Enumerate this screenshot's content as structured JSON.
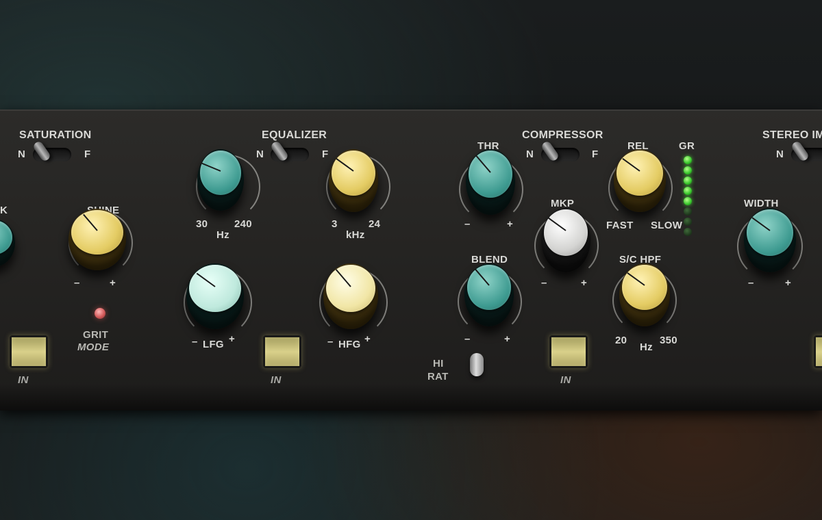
{
  "sections": {
    "saturation": "SATURATION",
    "equalizer": "EQUALIZER",
    "compressor": "COMPRESSOR",
    "stereo": "STEREO IM"
  },
  "toggle_labels": {
    "n": "N",
    "f": "F"
  },
  "left_knob_partial_label": "K",
  "shine": {
    "label": "SHINE",
    "min": "–",
    "max": "+",
    "value": 0.35
  },
  "grit_mode": {
    "line1": "GRIT",
    "line2": "MODE"
  },
  "in_label": "IN",
  "lf_freq": {
    "min": "30",
    "max": "240",
    "unit": "Hz",
    "value": 0.25
  },
  "hf_freq": {
    "min": "3",
    "max": "24",
    "unit": "kHz",
    "value": 0.3
  },
  "lfg": {
    "label": "LFG",
    "min": "–",
    "max": "+",
    "value": 0.3
  },
  "hfg": {
    "label": "HFG",
    "min": "–",
    "max": "+",
    "value": 0.35
  },
  "thr": {
    "label": "THR",
    "min": "–",
    "max": "+",
    "value": 0.35
  },
  "blend": {
    "label": "BLEND",
    "min": "–",
    "max": "+",
    "value": 0.35
  },
  "hi_rat": {
    "line1": "HI",
    "line2": "RAT"
  },
  "mkp": {
    "label": "MKP",
    "min": "–",
    "max": "+",
    "value": 0.3
  },
  "rel": {
    "label": "REL",
    "min": "FAST",
    "max": "SLOW",
    "value": 0.3
  },
  "sc_hpf": {
    "label": "S/C HPF",
    "min": "20",
    "max": "350",
    "unit": "Hz",
    "value": 0.3
  },
  "gr": {
    "label": "GR",
    "leds_lit": 5,
    "leds_total": 8
  },
  "width": {
    "label": "WIDTH",
    "min": "–",
    "max": "+",
    "value": 0.3
  }
}
